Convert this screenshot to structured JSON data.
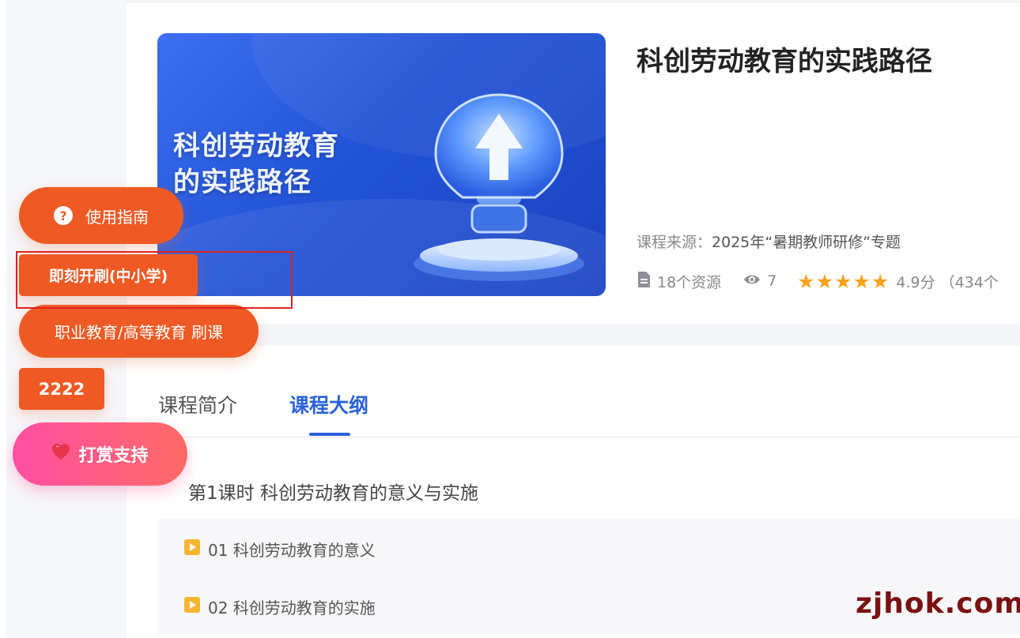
{
  "cover": {
    "title_line1": "科创劳动教育",
    "title_line2": "的实践路径",
    "icon": "lightbulb-upload-icon"
  },
  "course": {
    "title": "科创劳动教育的实践路径",
    "source_label": "课程来源：",
    "source_value": "2025年“暑期教师研修”专题",
    "resources": "18个资源",
    "views": "7",
    "rating_stars": 5,
    "score": "4.9分",
    "rating_count": "（434个"
  },
  "tabs": [
    {
      "label": "课程简介",
      "active": false
    },
    {
      "label": "课程大纲",
      "active": true
    }
  ],
  "outline": {
    "lesson_title": "第1课时 科创劳动教育的意义与实施",
    "items": [
      {
        "label": "01 科创劳动教育的意义",
        "icon": "video-icon"
      },
      {
        "label": "02 科创劳动教育的实施",
        "icon": "video-icon"
      }
    ]
  },
  "floating": {
    "guide": "使用指南",
    "k12": "即刻开刷(中小学)",
    "vocational": "职业教育/高等教育 刷课",
    "test": "2222",
    "tip": "打赏支持"
  },
  "watermark": "zjhok.com",
  "colors": {
    "accent_orange": "#ef5a24",
    "tab_blue": "#2a62dc",
    "star": "#f7a21b",
    "tip_pink": "#ff4fa3",
    "highlight_red": "#e02020"
  }
}
